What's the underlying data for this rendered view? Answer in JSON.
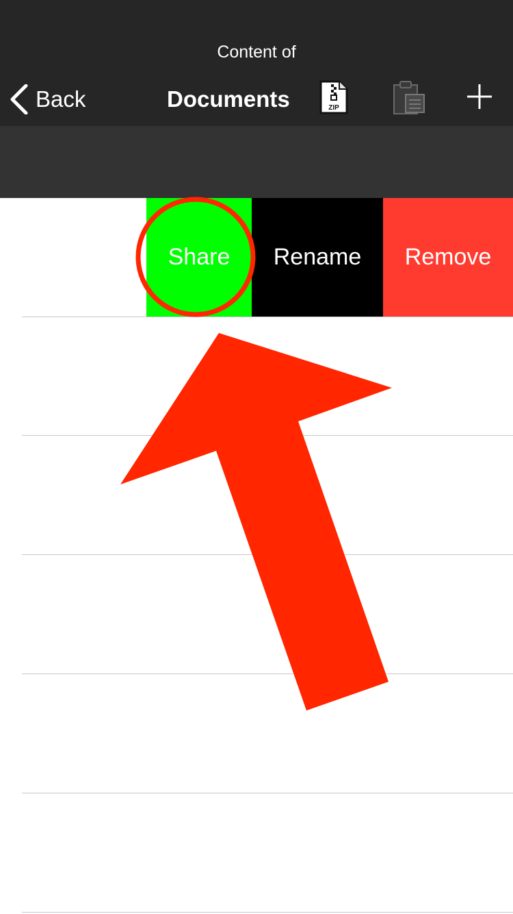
{
  "navbar": {
    "subtitle": "Content of",
    "title": "Documents",
    "back_label": "Back",
    "icons": [
      "chevron-left-icon",
      "zip-file-icon",
      "clipboard-paste-icon",
      "plus-icon"
    ]
  },
  "row_actions": {
    "share_label": "Share",
    "rename_label": "Rename",
    "remove_label": "Remove"
  },
  "colors": {
    "navbar": "#262626",
    "search_band": "#333333",
    "share": "#00ff00",
    "rename": "#000000",
    "remove": "#ff3b30",
    "annotation": "#ff2600"
  }
}
